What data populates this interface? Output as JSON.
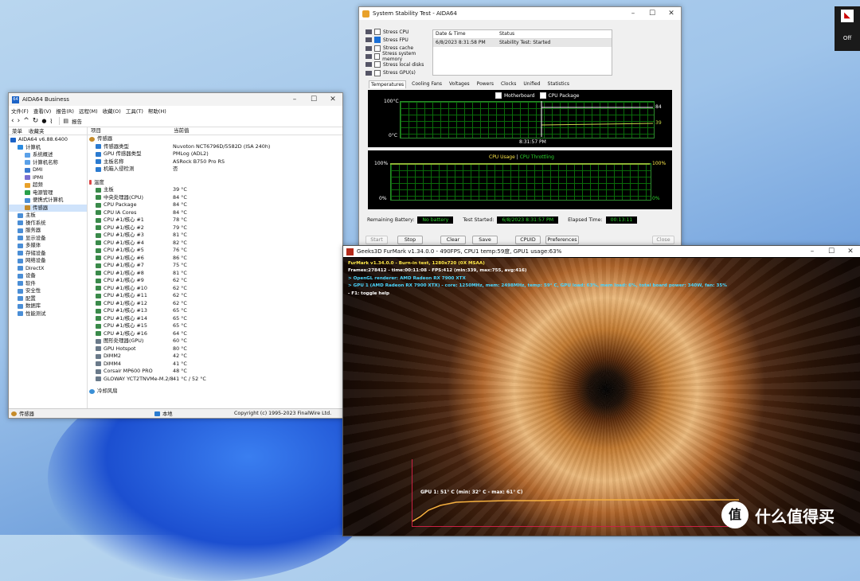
{
  "amd_widget": {
    "status": "Off"
  },
  "aida_main": {
    "title": "AIDA64 Business",
    "menu": [
      "文件(F)",
      "查看(V)",
      "报告(R)",
      "远程(M)",
      "收藏(O)",
      "工具(T)",
      "帮助(H)"
    ],
    "report_label": "报告",
    "tabs": [
      "菜单",
      "收藏夹"
    ],
    "tree": [
      {
        "label": "AIDA64 v6.88.6400",
        "depth": 0
      },
      {
        "label": "计算机",
        "depth": 1
      },
      {
        "label": "系统概述",
        "depth": 2
      },
      {
        "label": "计算机名称",
        "depth": 2
      },
      {
        "label": "DMI",
        "depth": 2
      },
      {
        "label": "IPMI",
        "depth": 2
      },
      {
        "label": "超频",
        "depth": 2
      },
      {
        "label": "电源管理",
        "depth": 2
      },
      {
        "label": "便携式计算机",
        "depth": 2
      },
      {
        "label": "传感器",
        "depth": 2
      },
      {
        "label": "主板",
        "depth": 1
      },
      {
        "label": "操作系统",
        "depth": 1
      },
      {
        "label": "服务器",
        "depth": 1
      },
      {
        "label": "显示设备",
        "depth": 1
      },
      {
        "label": "多媒体",
        "depth": 1
      },
      {
        "label": "存储设备",
        "depth": 1
      },
      {
        "label": "网络设备",
        "depth": 1
      },
      {
        "label": "DirectX",
        "depth": 1
      },
      {
        "label": "设备",
        "depth": 1
      },
      {
        "label": "软件",
        "depth": 1
      },
      {
        "label": "安全性",
        "depth": 1
      },
      {
        "label": "配置",
        "depth": 1
      },
      {
        "label": "数据库",
        "depth": 1
      },
      {
        "label": "性能测试",
        "depth": 1
      }
    ],
    "col_item": "项目",
    "col_value": "当前值",
    "sensor_section": "传感器",
    "sensor_rows": [
      {
        "name": "传感器类型",
        "value": "Nuvoton NCT6796D/5582D (ISA 240h)"
      },
      {
        "name": "GPU 传感器类型",
        "value": "PMLog (ADL2)"
      },
      {
        "name": "主板名称",
        "value": "ASRock B750 Pro RS"
      },
      {
        "name": "机箱入侵检测",
        "value": "否"
      }
    ],
    "temp_section": "温度",
    "temp_rows": [
      {
        "name": "主板",
        "value": "39 °C"
      },
      {
        "name": "中央处理器(CPU)",
        "value": "84 °C"
      },
      {
        "name": "CPU Package",
        "value": "84 °C"
      },
      {
        "name": "CPU IA Cores",
        "value": "84 °C"
      },
      {
        "name": "CPU #1/核心 #1",
        "value": "78 °C"
      },
      {
        "name": "CPU #1/核心 #2",
        "value": "79 °C"
      },
      {
        "name": "CPU #1/核心 #3",
        "value": "81 °C"
      },
      {
        "name": "CPU #1/核心 #4",
        "value": "82 °C"
      },
      {
        "name": "CPU #1/核心 #5",
        "value": "76 °C"
      },
      {
        "name": "CPU #1/核心 #6",
        "value": "86 °C"
      },
      {
        "name": "CPU #1/核心 #7",
        "value": "75 °C"
      },
      {
        "name": "CPU #1/核心 #8",
        "value": "81 °C"
      },
      {
        "name": "CPU #1/核心 #9",
        "value": "62 °C"
      },
      {
        "name": "CPU #1/核心 #10",
        "value": "62 °C"
      },
      {
        "name": "CPU #1/核心 #11",
        "value": "62 °C"
      },
      {
        "name": "CPU #1/核心 #12",
        "value": "62 °C"
      },
      {
        "name": "CPU #1/核心 #13",
        "value": "65 °C"
      },
      {
        "name": "CPU #1/核心 #14",
        "value": "65 °C"
      },
      {
        "name": "CPU #1/核心 #15",
        "value": "65 °C"
      },
      {
        "name": "CPU #1/核心 #16",
        "value": "64 °C"
      },
      {
        "name": "图形处理器(GPU)",
        "value": "60 °C"
      },
      {
        "name": "GPU Hotspot",
        "value": "80 °C"
      },
      {
        "name": "DIMM2",
        "value": "42 °C"
      },
      {
        "name": "DIMM4",
        "value": "41 °C"
      },
      {
        "name": "Corsair MP600 PRO",
        "value": "48 °C"
      },
      {
        "name": "GLOWAY YCT2TNVMe-M.2/80",
        "value": "41 °C / 52 °C"
      }
    ],
    "cooling_section": "冷却风扇",
    "status_left": "传感器",
    "status_mid": "本地",
    "status_right": "Copyright (c) 1995-2023 FinalWire Ltd."
  },
  "stability": {
    "title": "System Stability Test - AIDA64",
    "stress": [
      {
        "label": "Stress CPU",
        "checked": false
      },
      {
        "label": "Stress FPU",
        "checked": true
      },
      {
        "label": "Stress cache",
        "checked": false
      },
      {
        "label": "Stress system memory",
        "checked": false
      },
      {
        "label": "Stress local disks",
        "checked": false
      },
      {
        "label": "Stress GPU(s)",
        "checked": false
      }
    ],
    "log_headers": [
      "Date & Time",
      "Status"
    ],
    "log_row": {
      "date": "6/8/2023 8:31:58 PM",
      "status": "Stability Test: Started"
    },
    "tabs": [
      "Temperatures",
      "Cooling Fans",
      "Voltages",
      "Powers",
      "Clocks",
      "Unified",
      "Statistics"
    ],
    "temp_legend": [
      "Motherboard",
      "CPU Package"
    ],
    "temp_top": "100°C",
    "temp_bottom": "0°C",
    "temp_right_hi": "84",
    "temp_right_lo": "39",
    "temp_time": "8:31:57 PM",
    "usage_legend": [
      "CPU Usage",
      "CPU Throttling"
    ],
    "usage_top_left": "100%",
    "usage_bottom_left": "0%",
    "usage_top_right": "100%",
    "usage_bottom_right": "0%",
    "remaining_label": "Remaining Battery:",
    "remaining_value": "No battery",
    "started_label": "Test Started:",
    "started_value": "6/8/2023 8:31:57 PM",
    "elapsed_label": "Elapsed Time:",
    "elapsed_value": "00:13:11",
    "buttons": [
      "Start",
      "Stop",
      "Clear",
      "Save",
      "CPUID",
      "Preferences",
      "Close"
    ]
  },
  "furmark": {
    "title": "Geeks3D FurMark v1.34.0.0 - 490FPS, CPU1 temp:59度, GPU1 usage:63%",
    "lines": [
      "FurMark v1.34.0.0 - Burn-in test, 1280x720 (0X MSAA)",
      "Frames:278412 - time:00:11:08 - FPS:412 (min:339, max:755, avg:416)",
      "> OpenGL renderer: AMD Radeon RX 7900 XTX",
      "> GPU 1 (AMD Radeon RX 7900 XTX) - core: 1250MHz, mem: 2498MHz, temp: 59° C, GPU load: 63%, mem load: 6%, total board power: 340W, fan: 35%",
      "- F1: toggle help"
    ],
    "graph_label": "GPU 1: 51° C (min: 32° C - max: 61° C)"
  },
  "watermark": {
    "text": "什么值得买"
  }
}
